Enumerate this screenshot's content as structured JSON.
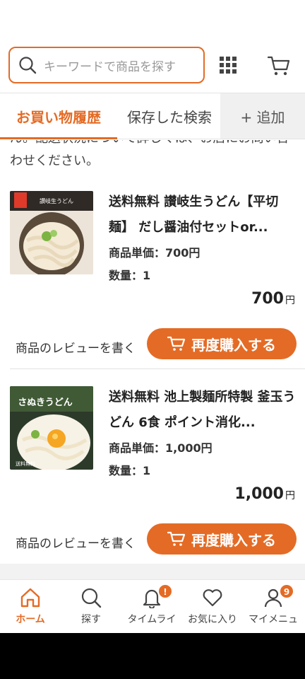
{
  "search": {
    "placeholder": "キーワードで商品を探す"
  },
  "tabs": [
    {
      "label": "お買い物履歴"
    },
    {
      "label": "保存した検索"
    },
    {
      "label": "+ 追加"
    }
  ],
  "notice": "ん。配送状況について詳しくは、お店にお問い合わせください。",
  "items": [
    {
      "title": "送料無料 讃岐生うどん【平切麺】 だし醤油付セットor...",
      "unit_price": "商品単価：700円",
      "qty": "数量：1",
      "price": "700",
      "yen": "円",
      "review": "商品のレビューを書く",
      "rebuy": "再度購入する",
      "thumb_text": "讃岐生うどん"
    },
    {
      "title": "送料無料 池上製麺所特製 釜玉うどん 6食 ポイント消化...",
      "unit_price": "商品単価：1,000円",
      "qty": "数量：1",
      "price": "1,000",
      "yen": "円",
      "review": "商品のレビューを書く",
      "rebuy": "再度購入する",
      "thumb_text": "さぬきうどん"
    }
  ],
  "nav": [
    {
      "label": "ホーム",
      "icon": "home-icon"
    },
    {
      "label": "探す",
      "icon": "search-icon"
    },
    {
      "label": "タイムライ",
      "icon": "bell-icon",
      "badge": "!"
    },
    {
      "label": "お気に入り",
      "icon": "heart-icon"
    },
    {
      "label": "マイメニュ",
      "icon": "user-icon",
      "badge": "9"
    }
  ],
  "colors": {
    "accent": "#e46b25"
  }
}
